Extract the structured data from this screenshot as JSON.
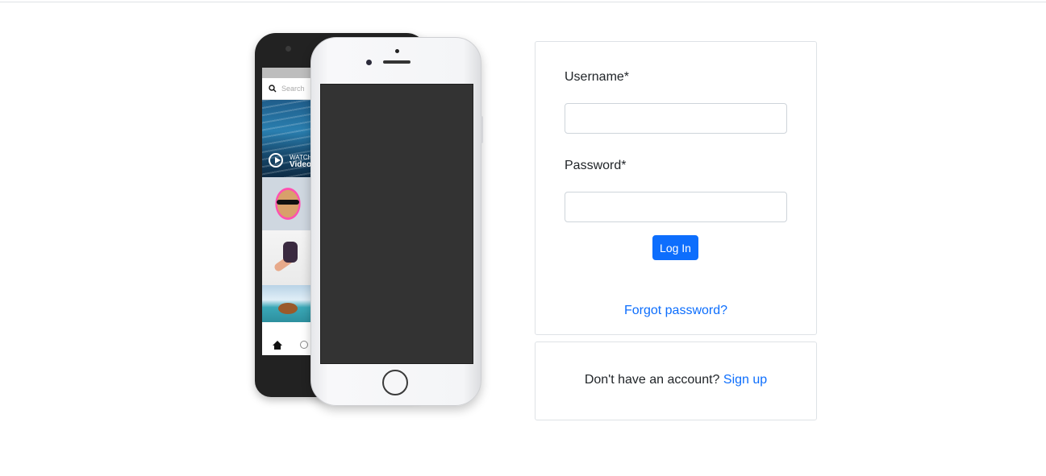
{
  "phone_mock": {
    "search_placeholder": "Search",
    "tile_watch": "WATCH",
    "tile_video": "Video"
  },
  "login": {
    "username_label": "Username*",
    "username_value": "",
    "password_label": "Password*",
    "password_value": "",
    "login_button": "Log In",
    "forgot_link": "Forgot password?"
  },
  "signup": {
    "prompt": "Don't have an account?",
    "link": "Sign up"
  },
  "colors": {
    "primary": "#0d6efd",
    "border": "#dee2e6",
    "text": "#212529"
  }
}
